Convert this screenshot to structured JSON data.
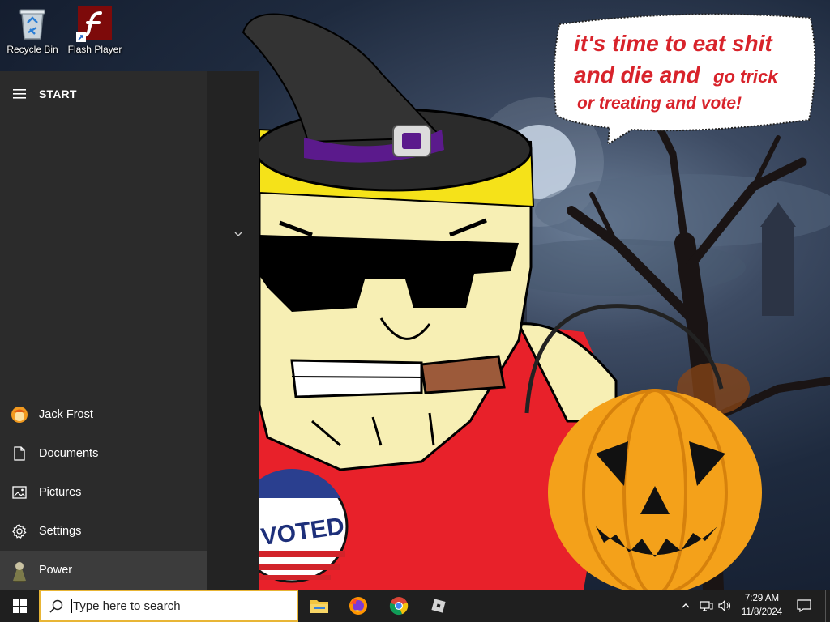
{
  "desktop": {
    "icons": [
      {
        "label": "Recycle Bin",
        "icon": "recycle-bin-icon"
      },
      {
        "label": "Flash Player",
        "icon": "flash-player-icon"
      }
    ]
  },
  "wallpaper": {
    "speech_bubble": {
      "line1": "it's time to eat shit",
      "line2a": "and die and",
      "line2b": "go trick",
      "line3": "or treating and vote!"
    },
    "badge": "VOTED",
    "colors": {
      "speech_text": "#d8232b",
      "shirt": "#e8212a",
      "pumpkin": "#f4a11a",
      "skin": "#f7efb4"
    }
  },
  "start_menu": {
    "title": "START",
    "rail": [
      {
        "label": "Jack Frost",
        "icon": "user-avatar-icon"
      },
      {
        "label": "Documents",
        "icon": "document-icon"
      },
      {
        "label": "Pictures",
        "icon": "pictures-icon"
      },
      {
        "label": "Settings",
        "icon": "gear-icon"
      },
      {
        "label": "Power",
        "icon": "power-icon"
      }
    ]
  },
  "taskbar": {
    "search_placeholder": "Type here to search",
    "apps": [
      "file-explorer-icon",
      "firefox-icon",
      "chrome-icon",
      "roblox-icon"
    ],
    "clock": {
      "time": "7:29 AM",
      "date": "11/8/2024"
    },
    "accent": "#e8b535"
  }
}
